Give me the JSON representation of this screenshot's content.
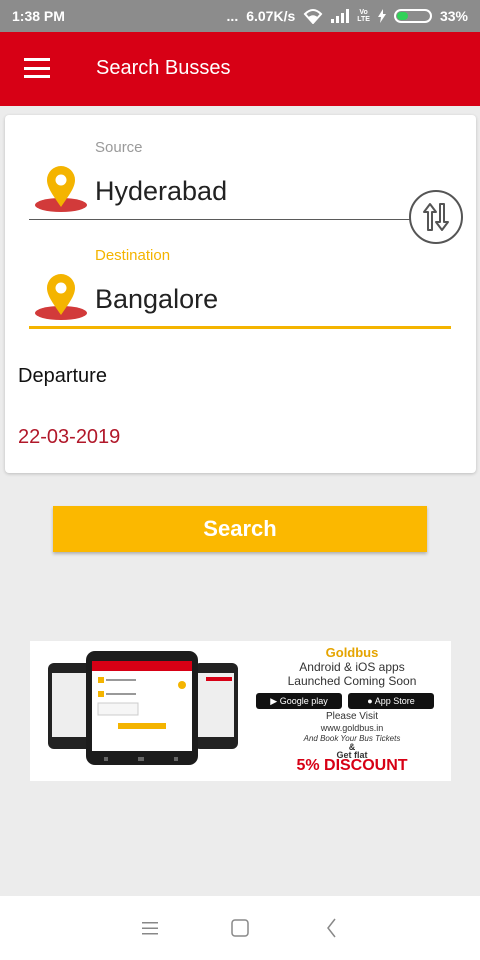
{
  "status_bar": {
    "time": "1:38 PM",
    "dots": "...",
    "net_speed": "6.07K/s",
    "volte_line1": "Vo",
    "volte_line2": "LTE",
    "battery_percent": "33%",
    "battery_level": 0.33
  },
  "app_bar": {
    "title": "Search Busses",
    "color": "#d70015"
  },
  "form": {
    "source": {
      "label": "Source",
      "value": "Hyderabad"
    },
    "destination": {
      "label": "Destination",
      "value": "Bangalore"
    },
    "departure": {
      "label": "Departure",
      "date": "22-03-2019"
    },
    "accent_color": "#f4b400",
    "date_color": "#b1182a"
  },
  "actions": {
    "search_label": "Search",
    "swap_icon": "swap-vertical-icon"
  },
  "ad": {
    "brand": "Goldbus",
    "apps_line": "Android & iOS apps",
    "launch_line": "Launched Coming Soon",
    "google_play": "Google play",
    "app_store": "App Store",
    "visit": "Please Visit",
    "url": "www.goldbus.in",
    "book": "And Book Your Bus Tickets",
    "amp": "&",
    "flat": "Get flat",
    "discount": "5% DISCOUNT"
  },
  "nav": {
    "menu_icon": "recent-apps-icon",
    "home_icon": "home-icon",
    "back_icon": "back-icon"
  }
}
